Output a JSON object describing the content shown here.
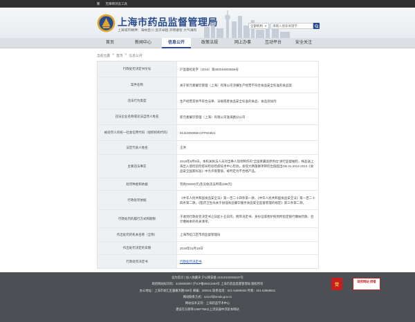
{
  "topbar": {
    "items": [
      "繁",
      "无障碍浏览工具"
    ]
  },
  "header": {
    "title": "上海市药品监督管理局",
    "slogan": "上海城市精神：海纳百川 追求卓越 开明睿智 大气谦和",
    "search": {
      "scope": "全部机构",
      "placeholder": "请输入搜索关键字"
    }
  },
  "nav": {
    "items": [
      {
        "label": "首页"
      },
      {
        "label": "新闻中心"
      },
      {
        "label": "信息公开"
      },
      {
        "label": "政策法规"
      },
      {
        "label": "网上办事"
      },
      {
        "label": "互动平台"
      },
      {
        "label": "安全关注"
      }
    ],
    "active": "信息公开"
  },
  "breadcrumb": {
    "items": [
      "当前位置",
      "首页",
      "信息公开"
    ],
    "separator": ">"
  },
  "detail": {
    "rows": [
      {
        "label": "行政处罚决定书文号",
        "value": "沪监督虹处字（2019）第092018003566号"
      },
      {
        "label": "案件名称",
        "value": "关于新元素餐饮管理（上海）有限公司涉嫌生产经营不符合食品安全标准的食品案"
      },
      {
        "label": "违法行为类型",
        "value": "生产经营其他不符合法律、法规或者食品安全标准的食品、食品添加剂"
      },
      {
        "label": "违法企业名称或违法自然人姓名",
        "value": "新元素餐饮管理（上海）有限公司淮海路分公司"
      },
      {
        "label": "被处罚人的统一社会信用代码（组织机构代码）",
        "value": "913100006MA1FP6GB2J"
      },
      {
        "label": "法定代表人姓名",
        "value": "王洪"
      },
      {
        "label": "主要违法事实",
        "value": "2018年8月9日，本机关执法人员对当事人现场制作的“全国青藏高原色拉”进行监督抽检，样品送上海出入境检验检疫局检验检疫技术中心检验，发现大肠菌群项目检出值超出GB 31-2012-2013《食品安全国家标准》中允许限量值，被判定为不合格产品。"
      },
      {
        "label": "处罚种类和依据",
        "value": "罚款(50000元)及没收违法所得(288元)"
      },
      {
        "label": "行政处罚依据",
        "value": "《中华人民共和国食品安全法》第一百二十四条第一款、《中华人民共和国食品安全法》第一百二十四条第二款，《医药卫生局关于加强食品餐饮服务食品安全监督管理的规定》第三条第二款。"
      },
      {
        "label": "行政处罚的履行方式和期限",
        "value": "于收到行政处罚决定书之日起十五日内，携带决定书、身份证或者护照到所指定银行缴纳罚款、合计缴纳本的有关清单。"
      },
      {
        "label": "作出处罚的机关名称（全称）",
        "value": "上海市虹口区市场监督管理局"
      },
      {
        "label": "作出处罚决定的日期",
        "value": "2019年01月18日"
      },
      {
        "label": "行政处罚决定书",
        "value": "行政处罚决定书",
        "link": true
      }
    ]
  },
  "footer": {
    "line1": "设为首页 | 加入收藏夹  沪公网安备 31010102004637号",
    "line2": "政府网站标识码：3100000007  沪ICP备05011593号  上海市药品监督管理局 版权所有",
    "line3": "办公地址：上海市徐汇区肇嘉浜路789号  邮编：200231  联系电话：021-54909300  传真：021-63558621",
    "line4": "网站联系方式：szzxzf@smda.gov.cn",
    "line5": "网站技术支持：上海药品学术中心",
    "line6": "建议在分辨率1366*768以上浏览器中浏览本网站",
    "badge_red": "党",
    "badge_gov": "政府网站 找错"
  },
  "colors": {
    "brand": "#2a4b8d",
    "nav_bg": "#dce0e5",
    "footer_bg": "#4c4f54",
    "label_bg": "#eef1f4"
  }
}
